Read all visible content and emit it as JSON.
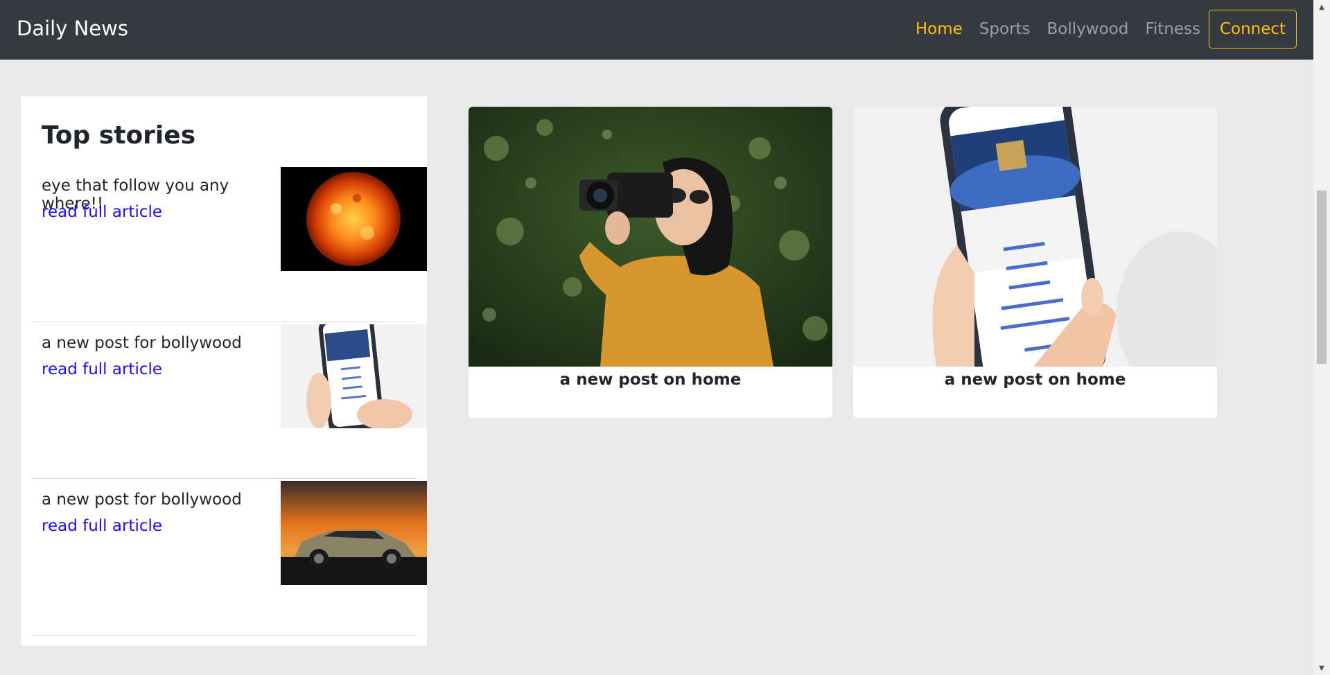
{
  "navbar": {
    "brand": "Daily News",
    "links": [
      "Home",
      "Sports",
      "Bollywood",
      "Fitness"
    ],
    "active_index": 0,
    "connect_label": "Connect"
  },
  "top_stories": {
    "title": "Top stories",
    "items": [
      {
        "text": "eye that follow you any where!!",
        "link": "read full article",
        "thumb": "sun-image"
      },
      {
        "text": "a new post for bollywood",
        "link": "read full article",
        "thumb": "phone-image"
      },
      {
        "text": "a new post for bollywood",
        "link": "read full article",
        "thumb": "car-image"
      }
    ]
  },
  "cards": [
    {
      "title": "a new post on home",
      "image": "photographer-image"
    },
    {
      "title": "a new post on home",
      "image": "phone-image"
    }
  ],
  "colors": {
    "navbar_bg": "#343a40",
    "accent": "#ffc107",
    "link": "#1a0dff",
    "page_bg": "#e9e9e9"
  }
}
